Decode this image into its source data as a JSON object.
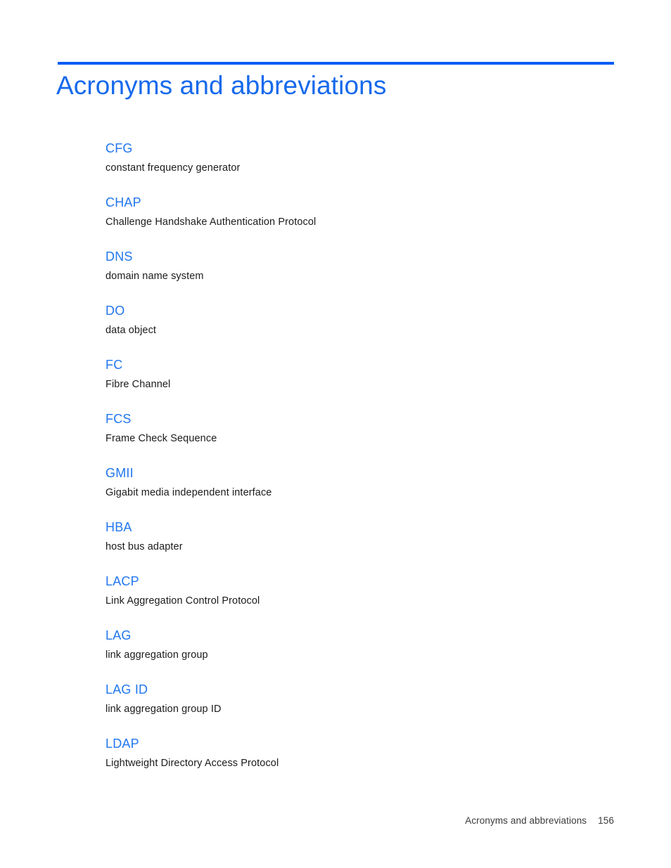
{
  "document": {
    "title": "Acronyms and abbreviations",
    "accent_color": "#0a5cf5",
    "heading_color": "#1669ec",
    "term_color": "#2277ee",
    "body_color": "#1b1b1b"
  },
  "glossary": {
    "entries": [
      {
        "term": "CFG",
        "definition": "constant frequency generator"
      },
      {
        "term": "CHAP",
        "definition": "Challenge Handshake Authentication Protocol"
      },
      {
        "term": "DNS",
        "definition": "domain name system"
      },
      {
        "term": "DO",
        "definition": "data object"
      },
      {
        "term": "FC",
        "definition": "Fibre Channel"
      },
      {
        "term": "FCS",
        "definition": "Frame Check Sequence"
      },
      {
        "term": "GMII",
        "definition": "Gigabit media independent interface"
      },
      {
        "term": "HBA",
        "definition": "host bus adapter"
      },
      {
        "term": "LACP",
        "definition": "Link Aggregation Control Protocol"
      },
      {
        "term": "LAG",
        "definition": "link aggregation group"
      },
      {
        "term": "LAG ID",
        "definition": "link aggregation group ID"
      },
      {
        "term": "LDAP",
        "definition": "Lightweight Directory Access Protocol"
      }
    ]
  },
  "footer": {
    "label": "Acronyms and abbreviations",
    "page_number": "156"
  }
}
